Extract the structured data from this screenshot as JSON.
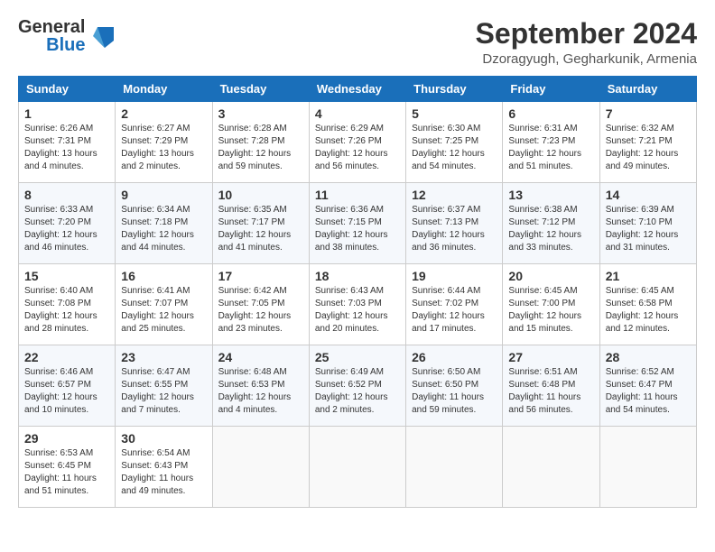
{
  "header": {
    "logo_general": "General",
    "logo_blue": "Blue",
    "logo_sub": "Blue",
    "month_title": "September 2024",
    "location": "Dzoragyugh, Gegharkunik, Armenia"
  },
  "weekdays": [
    "Sunday",
    "Monday",
    "Tuesday",
    "Wednesday",
    "Thursday",
    "Friday",
    "Saturday"
  ],
  "weeks": [
    [
      {
        "day": "1",
        "info": "Sunrise: 6:26 AM\nSunset: 7:31 PM\nDaylight: 13 hours\nand 4 minutes."
      },
      {
        "day": "2",
        "info": "Sunrise: 6:27 AM\nSunset: 7:29 PM\nDaylight: 13 hours\nand 2 minutes."
      },
      {
        "day": "3",
        "info": "Sunrise: 6:28 AM\nSunset: 7:28 PM\nDaylight: 12 hours\nand 59 minutes."
      },
      {
        "day": "4",
        "info": "Sunrise: 6:29 AM\nSunset: 7:26 PM\nDaylight: 12 hours\nand 56 minutes."
      },
      {
        "day": "5",
        "info": "Sunrise: 6:30 AM\nSunset: 7:25 PM\nDaylight: 12 hours\nand 54 minutes."
      },
      {
        "day": "6",
        "info": "Sunrise: 6:31 AM\nSunset: 7:23 PM\nDaylight: 12 hours\nand 51 minutes."
      },
      {
        "day": "7",
        "info": "Sunrise: 6:32 AM\nSunset: 7:21 PM\nDaylight: 12 hours\nand 49 minutes."
      }
    ],
    [
      {
        "day": "8",
        "info": "Sunrise: 6:33 AM\nSunset: 7:20 PM\nDaylight: 12 hours\nand 46 minutes."
      },
      {
        "day": "9",
        "info": "Sunrise: 6:34 AM\nSunset: 7:18 PM\nDaylight: 12 hours\nand 44 minutes."
      },
      {
        "day": "10",
        "info": "Sunrise: 6:35 AM\nSunset: 7:17 PM\nDaylight: 12 hours\nand 41 minutes."
      },
      {
        "day": "11",
        "info": "Sunrise: 6:36 AM\nSunset: 7:15 PM\nDaylight: 12 hours\nand 38 minutes."
      },
      {
        "day": "12",
        "info": "Sunrise: 6:37 AM\nSunset: 7:13 PM\nDaylight: 12 hours\nand 36 minutes."
      },
      {
        "day": "13",
        "info": "Sunrise: 6:38 AM\nSunset: 7:12 PM\nDaylight: 12 hours\nand 33 minutes."
      },
      {
        "day": "14",
        "info": "Sunrise: 6:39 AM\nSunset: 7:10 PM\nDaylight: 12 hours\nand 31 minutes."
      }
    ],
    [
      {
        "day": "15",
        "info": "Sunrise: 6:40 AM\nSunset: 7:08 PM\nDaylight: 12 hours\nand 28 minutes."
      },
      {
        "day": "16",
        "info": "Sunrise: 6:41 AM\nSunset: 7:07 PM\nDaylight: 12 hours\nand 25 minutes."
      },
      {
        "day": "17",
        "info": "Sunrise: 6:42 AM\nSunset: 7:05 PM\nDaylight: 12 hours\nand 23 minutes."
      },
      {
        "day": "18",
        "info": "Sunrise: 6:43 AM\nSunset: 7:03 PM\nDaylight: 12 hours\nand 20 minutes."
      },
      {
        "day": "19",
        "info": "Sunrise: 6:44 AM\nSunset: 7:02 PM\nDaylight: 12 hours\nand 17 minutes."
      },
      {
        "day": "20",
        "info": "Sunrise: 6:45 AM\nSunset: 7:00 PM\nDaylight: 12 hours\nand 15 minutes."
      },
      {
        "day": "21",
        "info": "Sunrise: 6:45 AM\nSunset: 6:58 PM\nDaylight: 12 hours\nand 12 minutes."
      }
    ],
    [
      {
        "day": "22",
        "info": "Sunrise: 6:46 AM\nSunset: 6:57 PM\nDaylight: 12 hours\nand 10 minutes."
      },
      {
        "day": "23",
        "info": "Sunrise: 6:47 AM\nSunset: 6:55 PM\nDaylight: 12 hours\nand 7 minutes."
      },
      {
        "day": "24",
        "info": "Sunrise: 6:48 AM\nSunset: 6:53 PM\nDaylight: 12 hours\nand 4 minutes."
      },
      {
        "day": "25",
        "info": "Sunrise: 6:49 AM\nSunset: 6:52 PM\nDaylight: 12 hours\nand 2 minutes."
      },
      {
        "day": "26",
        "info": "Sunrise: 6:50 AM\nSunset: 6:50 PM\nDaylight: 11 hours\nand 59 minutes."
      },
      {
        "day": "27",
        "info": "Sunrise: 6:51 AM\nSunset: 6:48 PM\nDaylight: 11 hours\nand 56 minutes."
      },
      {
        "day": "28",
        "info": "Sunrise: 6:52 AM\nSunset: 6:47 PM\nDaylight: 11 hours\nand 54 minutes."
      }
    ],
    [
      {
        "day": "29",
        "info": "Sunrise: 6:53 AM\nSunset: 6:45 PM\nDaylight: 11 hours\nand 51 minutes."
      },
      {
        "day": "30",
        "info": "Sunrise: 6:54 AM\nSunset: 6:43 PM\nDaylight: 11 hours\nand 49 minutes."
      },
      {
        "day": "",
        "info": ""
      },
      {
        "day": "",
        "info": ""
      },
      {
        "day": "",
        "info": ""
      },
      {
        "day": "",
        "info": ""
      },
      {
        "day": "",
        "info": ""
      }
    ]
  ]
}
